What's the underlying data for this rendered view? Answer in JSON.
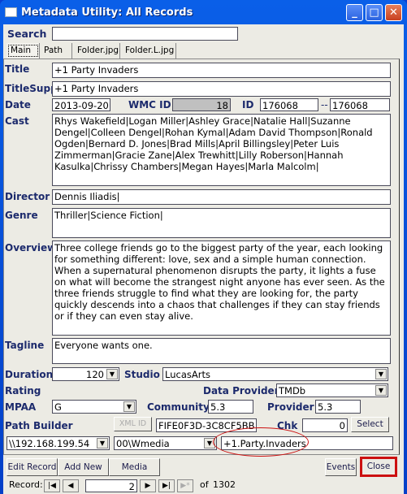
{
  "window": {
    "title": "Metadata Utility: All Records"
  },
  "search": {
    "label": "Search",
    "value": ""
  },
  "tabs": [
    {
      "label": "Main",
      "active": true
    },
    {
      "label": "Path"
    },
    {
      "label": "Folder.jpg"
    },
    {
      "label": "Folder.L.jpg"
    }
  ],
  "fields": {
    "title_label": "Title",
    "title": "+1 Party Invaders",
    "titlesupp_label": "TitleSupp",
    "titlesupp": "+1 Party Invaders",
    "date_label": "Date",
    "date": "2013-09-20",
    "wmcid_label": "WMC ID",
    "wmcid": "18",
    "id_label": "ID",
    "id_from": "176068",
    "id_sep": "--",
    "id_to": "176068",
    "cast_label": "Cast",
    "cast": "Rhys Wakefield|Logan Miller|Ashley Grace|Natalie Hall|Suzanne Dengel|Colleen Dengel|Rohan Kymal|Adam David Thompson|Ronald Ogden|Bernard D. Jones|Brad Mills|April Billingsley|Peter Luis Zimmerman|Gracie Zane|Alex Trewhitt|Lilly Roberson|Hannah Kasulka|Chrissy Chambers|Megan Hayes|Marla Malcolm|",
    "director_label": "Director",
    "director": "Dennis Iliadis|",
    "genre_label": "Genre",
    "genre": "Thriller|Science Fiction|",
    "overview_label": "Overview",
    "overview": "Three college friends go to the biggest party of the year, each looking for something different: love, sex and a simple human connection. When a supernatural phenomenon disrupts the party, it lights a fuse on what will become the strangest night anyone has ever seen. As the three friends struggle to find what they are looking for, the party quickly descends into a chaos that challenges if they can stay friends or if they can even stay alive.",
    "tagline_label": "Tagline",
    "tagline": "Everyone wants one.",
    "duration_label": "Duration",
    "duration": "120",
    "studio_label": "Studio",
    "studio": "LucasArts",
    "rating_label": "Rating",
    "provider_label": "Data Provider",
    "provider": "TMDb",
    "mpaa_label": "MPAA",
    "mpaa": "G",
    "community_label": "Community",
    "community": "5.3",
    "providerrating_label": "Provider",
    "providerrating": "5.3",
    "pathbuilder_label": "Path Builder",
    "xmlid_button": "XML ID",
    "xmlid": "FIFE0F3D-3C8CF5BB",
    "chk_label": "Chk",
    "chk": "0",
    "select_button": "Select",
    "server": "\\\\192.168.199.54",
    "share": "00\\Wmedia",
    "folder": "+1.Party.Invaders"
  },
  "buttons": {
    "edit": "Edit Record",
    "add": "Add New",
    "media": "Media",
    "events": "Events",
    "close": "Close"
  },
  "record": {
    "label": "Record:",
    "current": "2",
    "of_label": "of",
    "total": "1302"
  },
  "colors": {
    "highlight": "#cc1010"
  }
}
